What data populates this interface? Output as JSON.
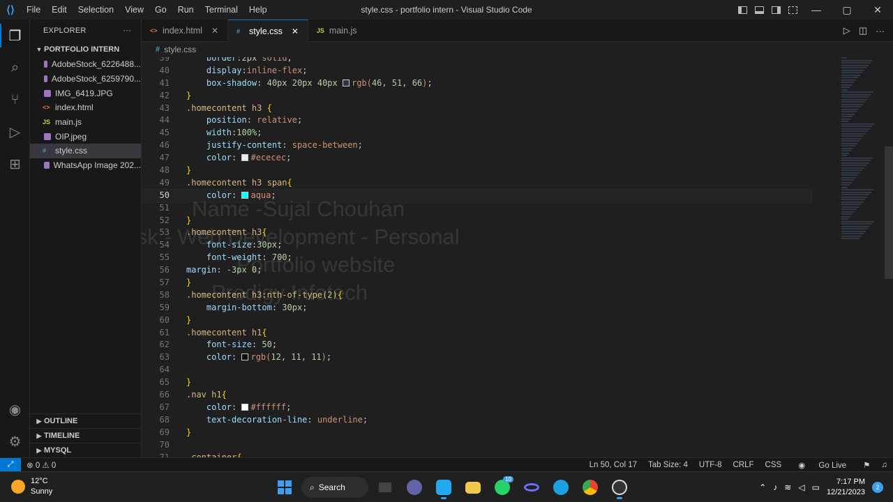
{
  "titlebar": {
    "logo": "⟨⟩",
    "menu": [
      "File",
      "Edit",
      "Selection",
      "View",
      "Go",
      "Run",
      "Terminal",
      "Help"
    ],
    "title": "style.css - portfolio intern - Visual Studio Code",
    "window_buttons": {
      "minimize": "—",
      "maximize": "▢",
      "close": "✕"
    }
  },
  "sidebar": {
    "header": "EXPLORER",
    "more": "···",
    "folder": "PORTFOLIO INTERN",
    "files": [
      {
        "name": "AdobeStock_6226488...",
        "type": "img"
      },
      {
        "name": "AdobeStock_6259790...",
        "type": "img"
      },
      {
        "name": "IMG_6419.JPG",
        "type": "img"
      },
      {
        "name": "index.html",
        "type": "html"
      },
      {
        "name": "main.js",
        "type": "js"
      },
      {
        "name": "OIP.jpeg",
        "type": "img"
      },
      {
        "name": "style.css",
        "type": "css"
      },
      {
        "name": "WhatsApp Image 202...",
        "type": "img"
      }
    ],
    "sections": [
      "OUTLINE",
      "TIMELINE",
      "MYSQL"
    ]
  },
  "tabs": [
    {
      "label": "index.html",
      "icon": "<>"
    },
    {
      "label": "style.css",
      "icon": "#"
    },
    {
      "label": "main.js",
      "icon": "JS"
    }
  ],
  "breadcrumb": {
    "icon": "#",
    "file": "style.css"
  },
  "editor": {
    "current_line": 50,
    "watermark": [
      "Name -Sujal Chouhan",
      "Task - Web Development - Personal",
      "Portfolio website",
      "Prodigy Infotech"
    ]
  },
  "colors": {
    "accent": "#0078d4",
    "selector": "#d7ba7d",
    "property": "#9cdcfe",
    "value": "#ce9178",
    "number": "#b5cea8",
    "bracket": "#ffd700",
    "swatch_shadow": "#2e3342",
    "swatch_ecececec": "#ececec",
    "swatch_aqua": "#00ffff",
    "swatch_dark": "#0c0b0b",
    "swatch_white": "#ffffff"
  },
  "statusbar": {
    "remote": "⤢",
    "problems": "⊗ 0 ⚠ 0",
    "position": "Ln 50, Col 17",
    "tab_size": "Tab Size: 4",
    "encoding": "UTF-8",
    "eol": "CRLF",
    "language": "CSS",
    "go_live": "Go Live"
  },
  "taskbar": {
    "temperature": "12°C",
    "condition": "Sunny",
    "search": "Search",
    "whatsapp_badge": "10",
    "time": "7:17 PM",
    "date": "12/21/2023",
    "notifications": "2"
  }
}
